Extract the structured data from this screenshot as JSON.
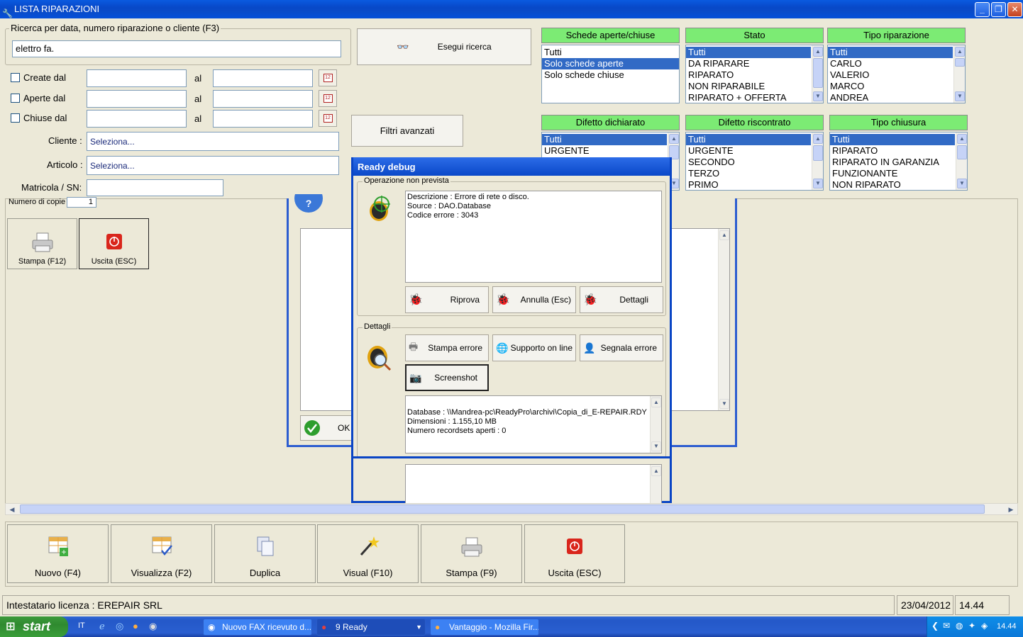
{
  "window": {
    "title": "LISTA RIPARAZIONI"
  },
  "search": {
    "group_label": "Ricerca per data, numero riparazione o cliente (F3)",
    "value": "elettro fa.",
    "exec_label": "Esegui ricerca",
    "advanced_label": "Filtri avanzati"
  },
  "dates": [
    {
      "label": "Create dal",
      "al": "al"
    },
    {
      "label": "Aperte dal",
      "al": "al"
    },
    {
      "label": "Chiuse dal",
      "al": "al"
    }
  ],
  "fields": {
    "cliente_label": "Cliente :",
    "cliente_value": "Seleziona...",
    "articolo_label": "Articolo :",
    "articolo_value": "Seleziona...",
    "matricola_label": "Matricola / SN:"
  },
  "lists": {
    "schede": {
      "title": "Schede aperte/chiuse",
      "items": [
        "Tutti",
        "Solo schede aperte",
        "Solo schede chiuse"
      ]
    },
    "stato": {
      "title": "Stato",
      "items": [
        "Tutti",
        "DA RIPARARE",
        "RIPARATO",
        "NON RIPARABILE",
        "RIPARATO + OFFERTA"
      ]
    },
    "tipo": {
      "title": "Tipo riparazione",
      "items": [
        "Tutti",
        "CARLO",
        "VALERIO",
        "MARCO",
        "ANDREA"
      ]
    },
    "difetto_dich": {
      "title": "Difetto dichiarato",
      "items": [
        "Tutti",
        "URGENTE"
      ]
    },
    "difetto_risc": {
      "title": "Difetto riscontrato",
      "items": [
        "Tutti",
        "URGENTE",
        "SECONDO",
        "TERZO",
        "PRIMO"
      ]
    },
    "chiusura": {
      "title": "Tipo chiusura",
      "items": [
        "Tutti",
        "RIPARATO",
        "RIPARATO IN GARANZIA",
        "FUNZIONANTE",
        "NON RIPARATO"
      ]
    }
  },
  "print_panel": {
    "copies_label": "Numero di copie",
    "copies_value": "1",
    "print_label": "Stampa (F12)",
    "exit_label": "Uscita (ESC)",
    "ok_label": "OK"
  },
  "debug": {
    "title": "Ready debug",
    "op_group": "Operazione non prevista",
    "message_lines": [
      "Descrizione : Errore di rete o disco.",
      "Source : DAO.Database",
      "Codice errore : 3043"
    ],
    "retry": "Riprova",
    "cancel": "Annulla (Esc)",
    "details": "Dettagli",
    "details_group": "Dettagli",
    "print_error": "Stampa errore",
    "support": "Supporto on line",
    "report": "Segnala errore",
    "screenshot": "Screenshot",
    "info_lines": [
      "Database : \\\\Mandrea-pc\\ReadyPro\\archivi\\Copia_di_E-REPAIR.RDY",
      "Dimensioni : 1.155,10 MB",
      "Numero recordsets aperti : 0"
    ]
  },
  "toolbar": {
    "new": "Nuovo (F4)",
    "view": "Visualizza (F2)",
    "dup": "Duplica",
    "visual": "Visual (F10)",
    "print": "Stampa (F9)",
    "exit": "Uscita (ESC)"
  },
  "status": {
    "license": "Intestatario licenza : EREPAIR SRL",
    "date": "23/04/2012",
    "time": "14.44"
  },
  "taskbar": {
    "start": "start",
    "lang": "IT",
    "tasks": [
      "Nuovo FAX ricevuto d...",
      "9 Ready",
      "Vantaggio - Mozilla Fir..."
    ],
    "clock": "14.44"
  }
}
